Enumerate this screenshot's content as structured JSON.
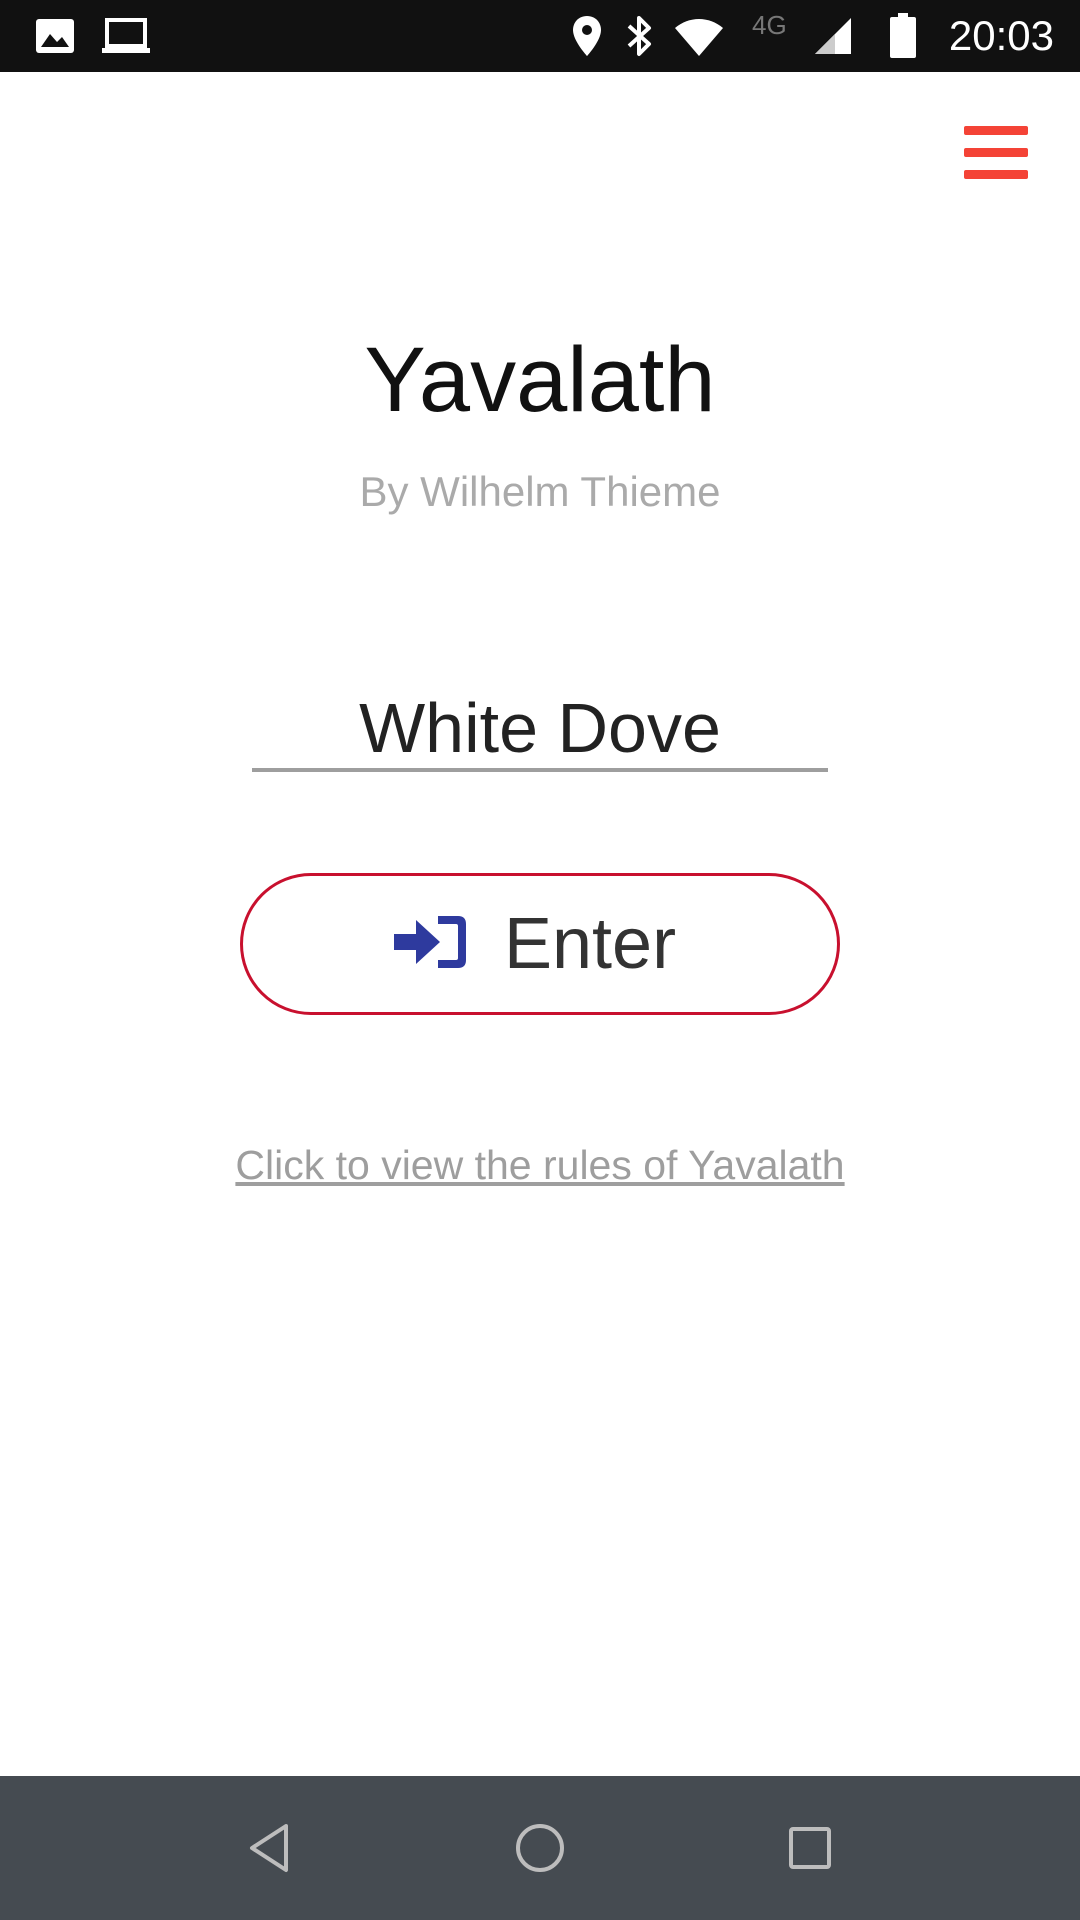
{
  "status_bar": {
    "time": "20:03",
    "network_label": "4G",
    "icons": [
      "image-icon",
      "laptop-icon",
      "location-icon",
      "bluetooth-icon",
      "wifi-icon",
      "signal-icon",
      "battery-icon"
    ]
  },
  "header": {
    "menu_icon": "hamburger-menu-icon"
  },
  "main": {
    "title": "Yavalath",
    "subtitle": "By Wilhelm Thieme",
    "name_input_value": "White Dove",
    "enter_button_label": "Enter",
    "enter_icon": "sign-in-icon",
    "rules_link": "Click to view the rules of Yavalath"
  },
  "nav_bar": {
    "buttons": [
      "back-icon",
      "home-icon",
      "recents-icon"
    ]
  },
  "colors": {
    "accent_red": "#f44336",
    "button_border": "#c8102e",
    "icon_blue": "#2e3a9e",
    "nav_bar": "#454b51",
    "status_bar": "#111111"
  }
}
